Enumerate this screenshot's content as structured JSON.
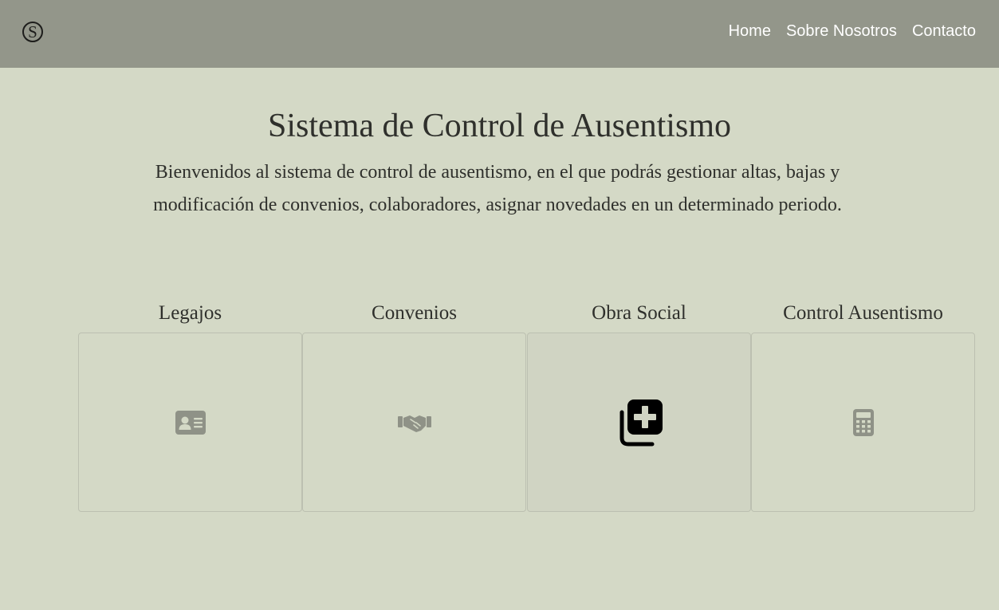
{
  "navbar": {
    "logo_letter": "S",
    "links": [
      "Home",
      "Sobre Nosotros",
      "Contacto"
    ]
  },
  "main": {
    "title": "Sistema de Control de Ausentismo",
    "intro_line1": "Bienvenidos al sistema de control de ausentismo, en el que podrás gestionar altas, bajas y",
    "intro_line2": "modificación de convenios, colaboradores, asignar novedades en un determinado periodo."
  },
  "cards": [
    {
      "label": "Legajos",
      "icon": "id-card-icon"
    },
    {
      "label": "Convenios",
      "icon": "handshake-icon"
    },
    {
      "label": "Obra Social",
      "icon": "medical-plus-icon"
    },
    {
      "label": "Control Ausentismo",
      "icon": "calculator-icon"
    }
  ],
  "colors": {
    "navbar": "#93968a",
    "background": "#d4d9c6",
    "icon_muted": "#8f9287",
    "icon_active": "#000000"
  }
}
